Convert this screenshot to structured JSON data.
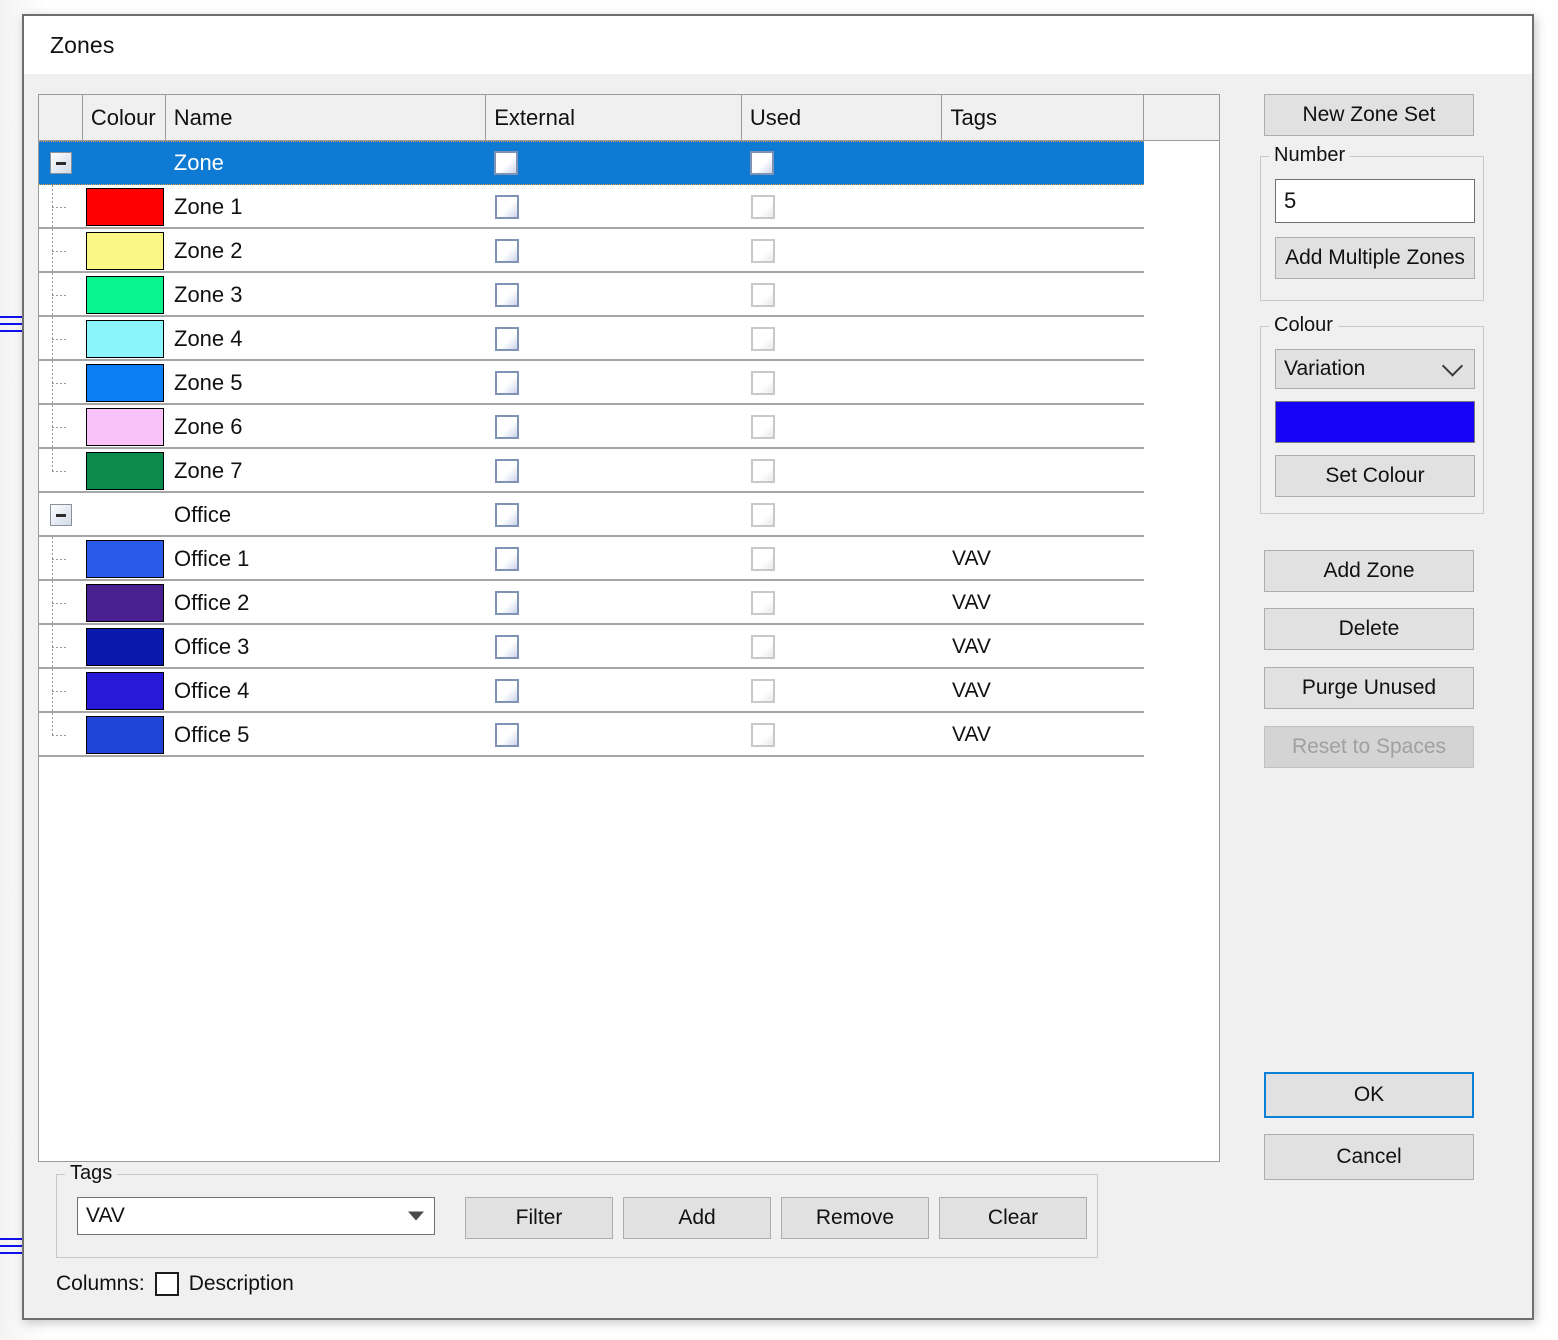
{
  "window": {
    "title": "Zones"
  },
  "grid": {
    "columns": [
      "",
      "Colour",
      "Name",
      "External",
      "Used",
      "Tags",
      ""
    ],
    "rows": [
      {
        "name": "Zone",
        "colour": null,
        "type": "group",
        "selected": true,
        "external": false,
        "used": false,
        "tags": ""
      },
      {
        "name": "Zone 1",
        "colour": "#FF0000",
        "type": "child",
        "selected": false,
        "external": false,
        "used": false,
        "tags": ""
      },
      {
        "name": "Zone 2",
        "colour": "#FBF787",
        "type": "child",
        "selected": false,
        "external": false,
        "used": false,
        "tags": ""
      },
      {
        "name": "Zone 3",
        "colour": "#07F48E",
        "type": "child",
        "selected": false,
        "external": false,
        "used": false,
        "tags": ""
      },
      {
        "name": "Zone 4",
        "colour": "#8BF5FB",
        "type": "child",
        "selected": false,
        "external": false,
        "used": false,
        "tags": ""
      },
      {
        "name": "Zone 5",
        "colour": "#0C7DF3",
        "type": "child",
        "selected": false,
        "external": false,
        "used": false,
        "tags": ""
      },
      {
        "name": "Zone 6",
        "colour": "#F9C3F9",
        "type": "child",
        "selected": false,
        "external": false,
        "used": false,
        "tags": ""
      },
      {
        "name": "Zone 7",
        "colour": "#0A8A4C",
        "type": "child",
        "selected": false,
        "external": false,
        "used": false,
        "tags": ""
      },
      {
        "name": "Office",
        "colour": null,
        "type": "group",
        "selected": false,
        "external": false,
        "used": false,
        "tags": ""
      },
      {
        "name": "Office 1",
        "colour": "#2A5BE8",
        "type": "child",
        "selected": false,
        "external": false,
        "used": false,
        "tags": "VAV"
      },
      {
        "name": "Office 2",
        "colour": "#4A2090",
        "type": "child",
        "selected": false,
        "external": false,
        "used": false,
        "tags": "VAV"
      },
      {
        "name": "Office 3",
        "colour": "#0918AD",
        "type": "child",
        "selected": false,
        "external": false,
        "used": false,
        "tags": "VAV"
      },
      {
        "name": "Office 4",
        "colour": "#2818D8",
        "type": "child",
        "selected": false,
        "external": false,
        "used": false,
        "tags": "VAV"
      },
      {
        "name": "Office 5",
        "colour": "#1E44D8",
        "type": "child",
        "selected": false,
        "external": false,
        "used": false,
        "tags": "VAV"
      }
    ]
  },
  "right_panel": {
    "new_zone_set": "New Zone Set",
    "number_group": {
      "legend": "Number",
      "value": "5",
      "add_multiple": "Add Multiple Zones"
    },
    "colour_group": {
      "legend": "Colour",
      "mode": "Variation",
      "swatch": "#1603F6",
      "set_colour": "Set Colour"
    },
    "add_zone": "Add Zone",
    "delete": "Delete",
    "purge_unused": "Purge Unused",
    "reset_to_spaces": "Reset to Spaces",
    "ok": "OK",
    "cancel": "Cancel"
  },
  "tags_panel": {
    "legend": "Tags",
    "selected_tag": "VAV",
    "filter": "Filter",
    "add": "Add",
    "remove": "Remove",
    "clear": "Clear"
  },
  "columns_row": {
    "label": "Columns:",
    "description": "Description"
  }
}
